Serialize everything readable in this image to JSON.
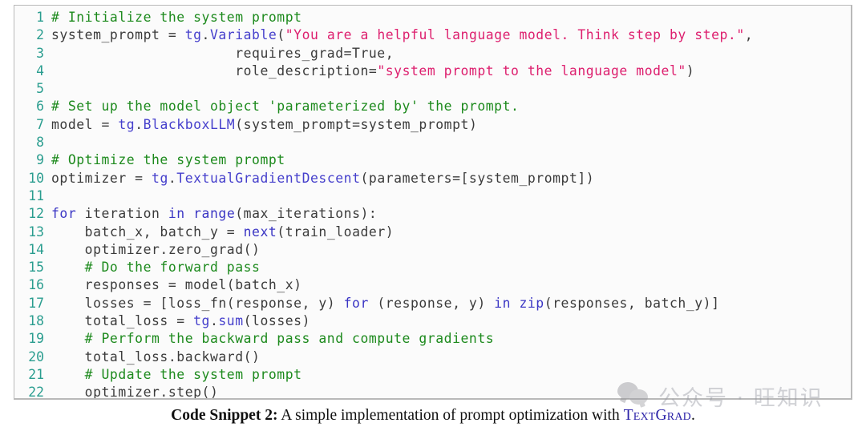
{
  "figure": {
    "kind": "code-snippet-figure",
    "caption": {
      "label": "Code Snippet 2:",
      "body_before": " A simple implementation of prompt optimization with ",
      "brand": "TextGrad",
      "body_after": "."
    }
  },
  "code_block": {
    "language": "python",
    "background_color": "#fbfbfb",
    "border_color": "#b9b9b9",
    "linenumber_color": "#2a9d8f",
    "token_colors": {
      "comment": "#1d8a1d",
      "string": "#dd1f6e",
      "keyword": "#3b36c4",
      "function": "#4640cc",
      "plain": "#3b3b3b"
    },
    "lines": [
      {
        "n": "1",
        "tokens": [
          {
            "t": "# Initialize the system prompt",
            "c": "com"
          }
        ]
      },
      {
        "n": "2",
        "tokens": [
          {
            "t": "system_prompt = ",
            "c": "pln"
          },
          {
            "t": "tg",
            "c": "fn"
          },
          {
            "t": ".",
            "c": "pln"
          },
          {
            "t": "Variable",
            "c": "fn"
          },
          {
            "t": "(",
            "c": "pln"
          },
          {
            "t": "\"You are a helpful language model. Think step by step.\"",
            "c": "str"
          },
          {
            "t": ",",
            "c": "pln"
          }
        ]
      },
      {
        "n": "3",
        "tokens": [
          {
            "t": "                      requires_grad=True,",
            "c": "pln"
          }
        ]
      },
      {
        "n": "4",
        "tokens": [
          {
            "t": "                      role_description=",
            "c": "pln"
          },
          {
            "t": "\"system prompt to the language model\"",
            "c": "str"
          },
          {
            "t": ")",
            "c": "pln"
          }
        ]
      },
      {
        "n": "5",
        "tokens": [
          {
            "t": "",
            "c": "pln"
          }
        ]
      },
      {
        "n": "6",
        "tokens": [
          {
            "t": "# Set up the model object 'parameterized by' the prompt.",
            "c": "com"
          }
        ]
      },
      {
        "n": "7",
        "tokens": [
          {
            "t": "model = ",
            "c": "pln"
          },
          {
            "t": "tg",
            "c": "fn"
          },
          {
            "t": ".",
            "c": "pln"
          },
          {
            "t": "BlackboxLLM",
            "c": "fn"
          },
          {
            "t": "(system_prompt=system_prompt)",
            "c": "pln"
          }
        ]
      },
      {
        "n": "8",
        "tokens": [
          {
            "t": "",
            "c": "pln"
          }
        ]
      },
      {
        "n": "9",
        "tokens": [
          {
            "t": "# Optimize the system prompt",
            "c": "com"
          }
        ]
      },
      {
        "n": "10",
        "tokens": [
          {
            "t": "optimizer = ",
            "c": "pln"
          },
          {
            "t": "tg",
            "c": "fn"
          },
          {
            "t": ".",
            "c": "pln"
          },
          {
            "t": "TextualGradientDescent",
            "c": "fn"
          },
          {
            "t": "(parameters=[system_prompt])",
            "c": "pln"
          }
        ]
      },
      {
        "n": "11",
        "tokens": [
          {
            "t": "",
            "c": "pln"
          }
        ]
      },
      {
        "n": "12",
        "tokens": [
          {
            "t": "for",
            "c": "kw"
          },
          {
            "t": " iteration ",
            "c": "pln"
          },
          {
            "t": "in",
            "c": "kw"
          },
          {
            "t": " ",
            "c": "pln"
          },
          {
            "t": "range",
            "c": "kw"
          },
          {
            "t": "(max_iterations):",
            "c": "pln"
          }
        ]
      },
      {
        "n": "13",
        "tokens": [
          {
            "t": "    batch_x, batch_y = ",
            "c": "pln"
          },
          {
            "t": "next",
            "c": "kw"
          },
          {
            "t": "(train_loader)",
            "c": "pln"
          }
        ]
      },
      {
        "n": "14",
        "tokens": [
          {
            "t": "    optimizer.zero_grad()",
            "c": "pln"
          }
        ]
      },
      {
        "n": "15",
        "tokens": [
          {
            "t": "    # Do the forward pass",
            "c": "com"
          }
        ]
      },
      {
        "n": "16",
        "tokens": [
          {
            "t": "    responses = model(batch_x)",
            "c": "pln"
          }
        ]
      },
      {
        "n": "17",
        "tokens": [
          {
            "t": "    losses = [loss_fn(response, y) ",
            "c": "pln"
          },
          {
            "t": "for",
            "c": "kw"
          },
          {
            "t": " (response, y) ",
            "c": "pln"
          },
          {
            "t": "in",
            "c": "kw"
          },
          {
            "t": " ",
            "c": "pln"
          },
          {
            "t": "zip",
            "c": "kw"
          },
          {
            "t": "(responses, batch_y)]",
            "c": "pln"
          }
        ]
      },
      {
        "n": "18",
        "tokens": [
          {
            "t": "    total_loss = ",
            "c": "pln"
          },
          {
            "t": "tg",
            "c": "fn"
          },
          {
            "t": ".",
            "c": "pln"
          },
          {
            "t": "sum",
            "c": "fn"
          },
          {
            "t": "(losses)",
            "c": "pln"
          }
        ]
      },
      {
        "n": "19",
        "tokens": [
          {
            "t": "    # Perform the backward pass and compute gradients",
            "c": "com"
          }
        ]
      },
      {
        "n": "20",
        "tokens": [
          {
            "t": "    total_loss.backward()",
            "c": "pln"
          }
        ]
      },
      {
        "n": "21",
        "tokens": [
          {
            "t": "    # Update the system prompt",
            "c": "com"
          }
        ]
      },
      {
        "n": "22",
        "tokens": [
          {
            "t": "    optimizer.step()",
            "c": "pln"
          }
        ]
      }
    ]
  },
  "watermark": {
    "icon": "wechat-logo-icon",
    "text": "公众号 · 旺知识"
  }
}
